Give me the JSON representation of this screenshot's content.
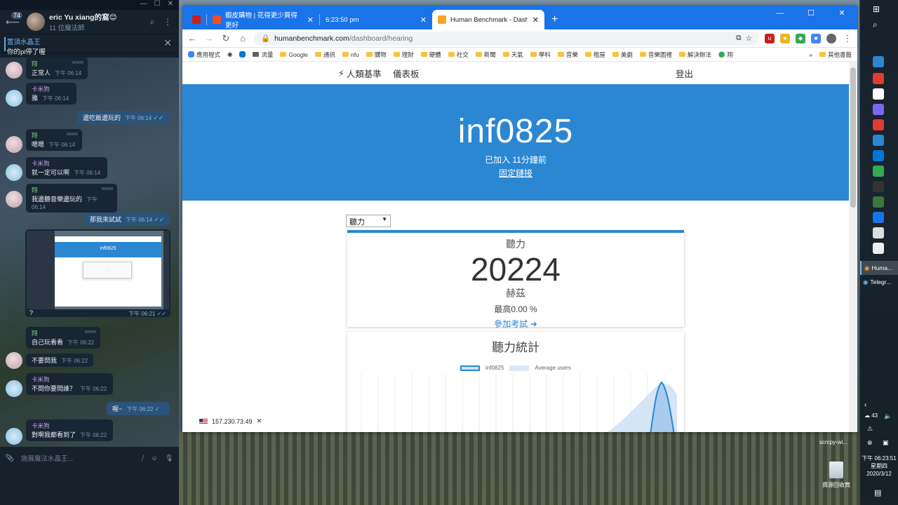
{
  "telegram": {
    "unread_count": "74",
    "chat_name": "eric Yu xiang的窩😊",
    "chat_status": "11 位魔法師",
    "pinned": {
      "title": "置頂水晶王",
      "text": "你的pi停了喔"
    },
    "messages": [
      {
        "side": "in",
        "who": "翔",
        "who_color": "g",
        "text": "正常人",
        "time": "下午 06:14",
        "hint": "www"
      },
      {
        "side": "in",
        "who": "卡米狗",
        "who_color": "p",
        "text": "雅",
        "time": "下午 06:14",
        "hint": ""
      },
      {
        "side": "out",
        "text": "邊吃飯邊玩的",
        "time": "下午 06:14"
      },
      {
        "side": "in",
        "who": "翔",
        "who_color": "g",
        "text": "嗯嗯",
        "time": "下午 06:14",
        "hint": "www"
      },
      {
        "side": "in",
        "who": "卡米狗",
        "who_color": "p",
        "text": "就一定可以啊",
        "time": "下午 06:14",
        "hint": ""
      },
      {
        "side": "in",
        "who": "翔",
        "who_color": "g",
        "text": "我邊聽音樂邊玩的",
        "time": "下午 06:14",
        "hint": "www"
      },
      {
        "side": "out",
        "text": "那我來試試",
        "time": "下午 06:14"
      },
      {
        "side": "out",
        "text": "?",
        "time": "下午 06:21"
      },
      {
        "side": "in",
        "who": "翔",
        "who_color": "g",
        "text": "自己玩看看",
        "time": "下午 06:22",
        "hint": "www"
      },
      {
        "side": "in",
        "who": "",
        "who_color": "g",
        "text": "不要問我",
        "time": "下午 06:22",
        "hint": ""
      },
      {
        "side": "in",
        "who": "卡米狗",
        "who_color": "p",
        "text": "不問你要問誰？",
        "time": "下午 06:22",
        "hint": ""
      },
      {
        "side": "out",
        "text": "喔~",
        "time": "下午 06:22"
      },
      {
        "side": "in",
        "who": "卡米狗",
        "who_color": "p",
        "text": "對啊我都看到了",
        "time": "下午 06:22",
        "hint": ""
      }
    ],
    "photo_caption": {
      "title": "inf0825",
      "score": "10"
    },
    "input_placeholder": "施展魔法水晶王..."
  },
  "chrome": {
    "tabs": [
      {
        "title": "",
        "favicon_color": "#c5221f"
      },
      {
        "title": "蝦皮購物 | 花得更少買得更好",
        "favicon_color": "#ee4d2d"
      },
      {
        "title": "6:23:50 pm",
        "favicon_color": ""
      },
      {
        "title": "Human Benchmark - Dashboard",
        "favicon_color": "#f5a623"
      }
    ],
    "new_tab": "+",
    "window_controls": [
      "—",
      "☐",
      "✕"
    ],
    "url_host": "humanbenchmark.com",
    "url_path": "/dashboard/hearing",
    "bookmarks": [
      "應用程式",
      "流量",
      "Google",
      "通訊",
      "nfu",
      "購物",
      "理財",
      "硬體",
      "社交",
      "新聞",
      "天氣",
      "學科",
      "音樂",
      "租屋",
      "美劇",
      "音樂圖裡",
      "解決辦法",
      "翔"
    ],
    "bookmarks_more": "»",
    "other_bookmarks": "其他書籤"
  },
  "page": {
    "nav": {
      "brand": "人類基準",
      "dashboard": "儀表板",
      "logout": "登出"
    },
    "hero": {
      "username": "inf0825",
      "joined": "已加入 11分鐘前",
      "permalink": "固定鏈接"
    },
    "select_value": "聽力",
    "card": {
      "label": "聽力",
      "score": "20224",
      "unit": "赫茲",
      "top": "最高0.00 %",
      "play": "參加考試"
    },
    "stats": {
      "title": "聽力統計",
      "legend_user": "inf0825",
      "legend_avg": "Average users"
    },
    "ip": "157.230.73.49"
  },
  "chart_data": {
    "type": "area",
    "series": [
      {
        "name": "inf0825",
        "color": "#2b87d1"
      },
      {
        "name": "Average users",
        "color": "#cfe2f5"
      }
    ]
  },
  "taskbar": {
    "apps": [
      "Huma...",
      "Telegr..."
    ],
    "temp": "43",
    "clock_time": "下午 06:23:51",
    "clock_day": "星期四",
    "clock_date": "2020/3/12"
  },
  "desktop": {
    "recycle_bin": "資源回收筒",
    "scrcpy": "scrcpy-wi..."
  }
}
